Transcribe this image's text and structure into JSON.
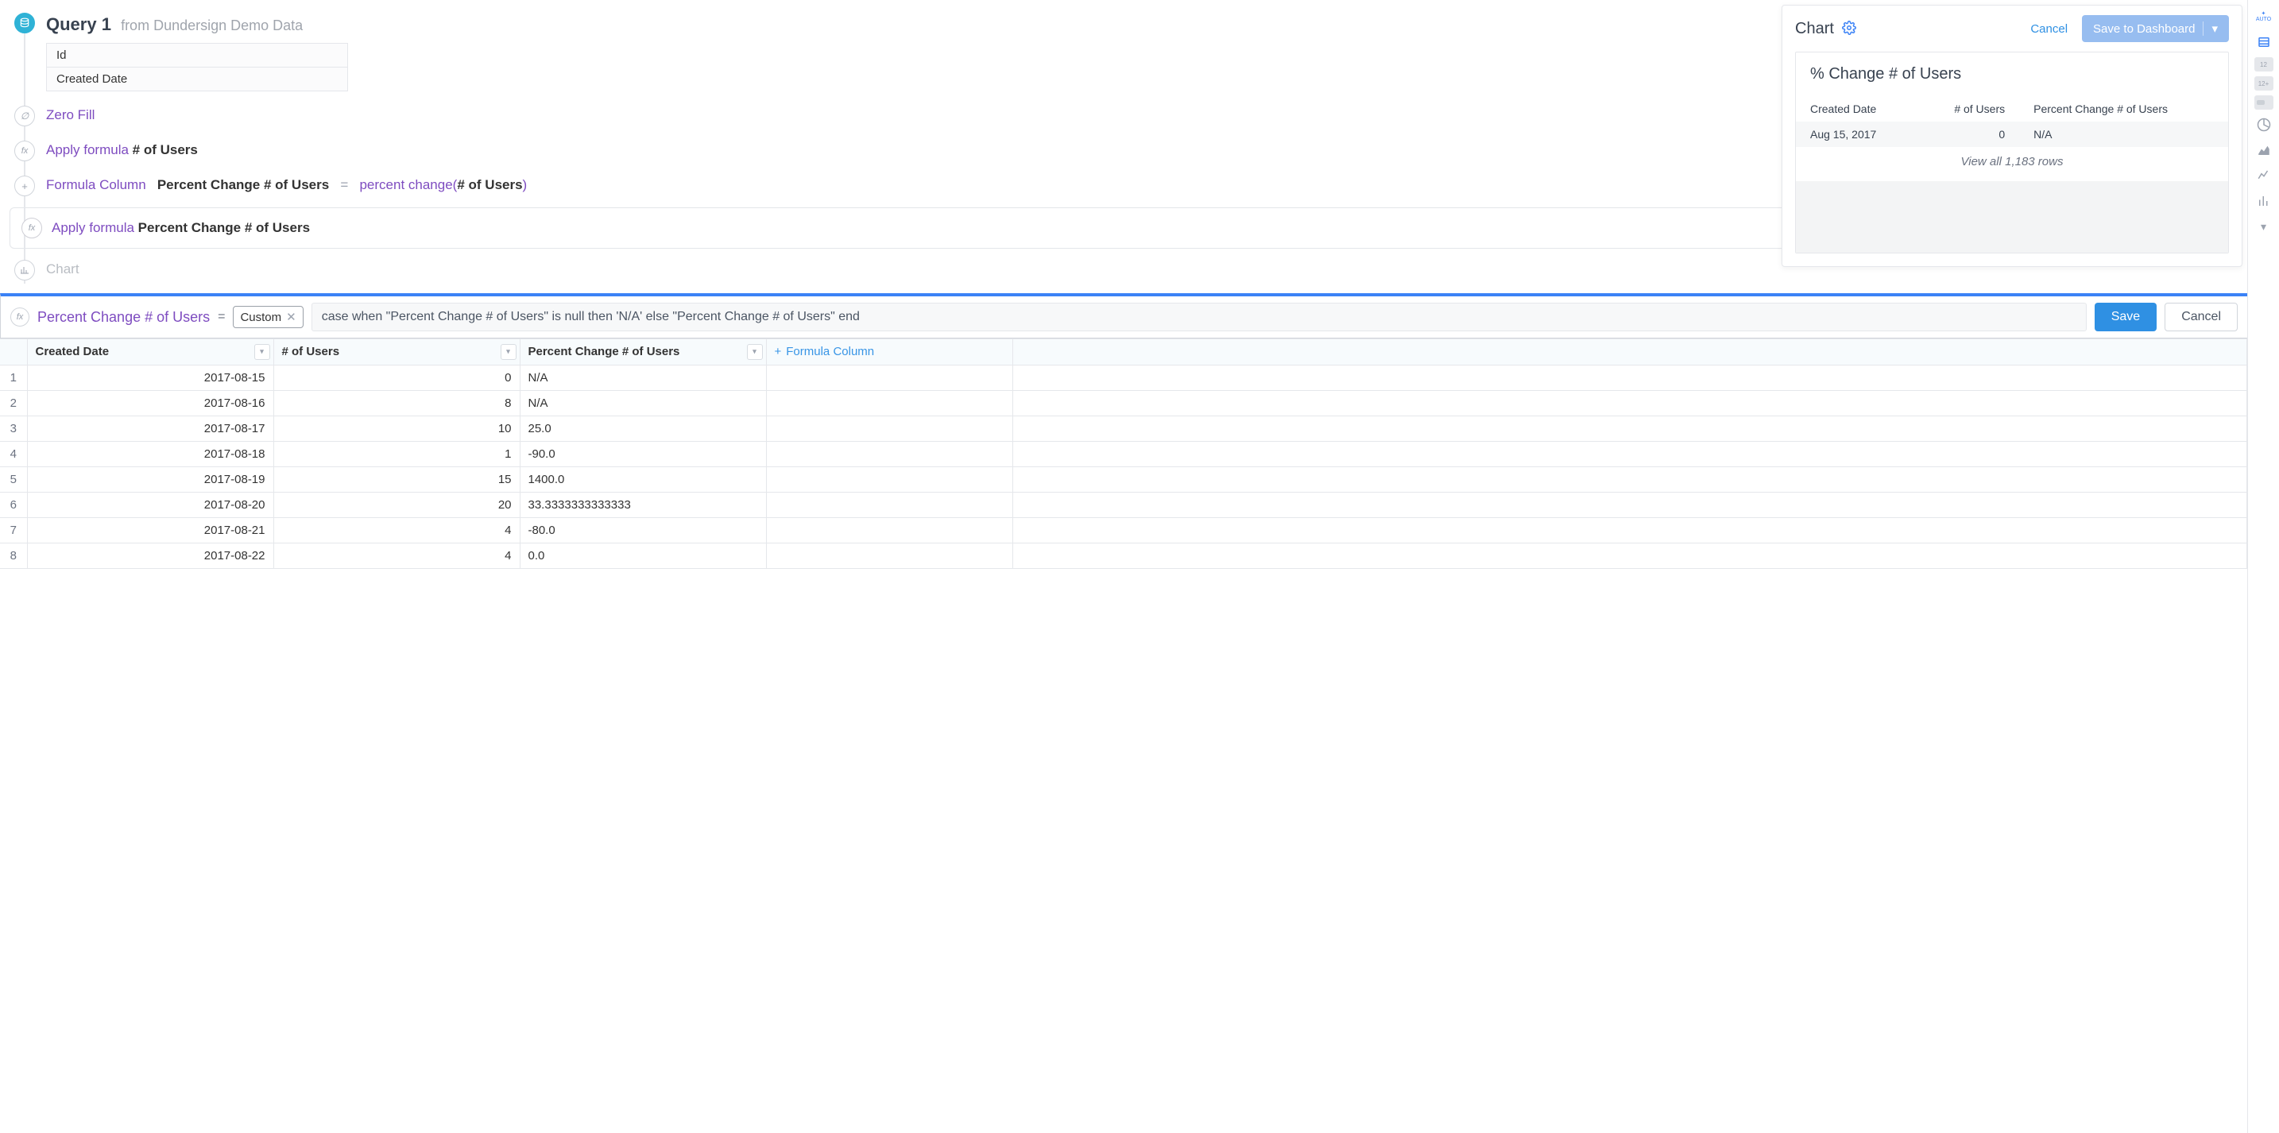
{
  "header": {
    "query_title": "Query 1",
    "from_label": "from",
    "datasource": "Dundersign Demo Data",
    "fields": [
      "Id",
      "Created Date"
    ]
  },
  "pipeline": {
    "zero_fill": "Zero Fill",
    "apply_formula_1_prefix": "Apply formula",
    "apply_formula_1_col": "# of Users",
    "formula_col_label": "Formula Column",
    "formula_col_name": "Percent Change # of Users",
    "formula_col_eq": "=",
    "formula_col_fn": "percent change(",
    "formula_col_arg": "# of Users",
    "formula_col_close": ")",
    "apply_formula_2_prefix": "Apply formula",
    "apply_formula_2_col": "Percent Change # of Users",
    "chart_step": "Chart"
  },
  "chart_panel": {
    "title": "Chart",
    "cancel": "Cancel",
    "save": "Save to Dashboard",
    "card_title": "% Change # of Users",
    "columns": [
      "Created Date",
      "# of Users",
      "Percent Change # of Users"
    ],
    "row": {
      "date": "Aug 15, 2017",
      "users": "0",
      "pct": "N/A"
    },
    "view_all": "View all 1,183 rows"
  },
  "formula_bar": {
    "name": "Percent Change # of Users",
    "eq": "=",
    "type": "Custom",
    "expr": "case when \"Percent Change # of Users\" is null then 'N/A' else \"Percent Change # of Users\" end",
    "save": "Save",
    "cancel": "Cancel"
  },
  "table": {
    "headers": [
      "Created Date",
      "# of Users",
      "Percent Change # of Users"
    ],
    "add_col": "Formula Column",
    "rows": [
      {
        "n": "1",
        "date": "2017-08-15",
        "users": "0",
        "pct": "N/A"
      },
      {
        "n": "2",
        "date": "2017-08-16",
        "users": "8",
        "pct": "N/A"
      },
      {
        "n": "3",
        "date": "2017-08-17",
        "users": "10",
        "pct": "25.0"
      },
      {
        "n": "4",
        "date": "2017-08-18",
        "users": "1",
        "pct": "-90.0"
      },
      {
        "n": "5",
        "date": "2017-08-19",
        "users": "15",
        "pct": "1400.0"
      },
      {
        "n": "6",
        "date": "2017-08-20",
        "users": "20",
        "pct": "33.3333333333333"
      },
      {
        "n": "7",
        "date": "2017-08-21",
        "users": "4",
        "pct": "-80.0"
      },
      {
        "n": "8",
        "date": "2017-08-22",
        "users": "4",
        "pct": "0.0"
      }
    ]
  },
  "rail": {
    "auto": "AUTO"
  }
}
